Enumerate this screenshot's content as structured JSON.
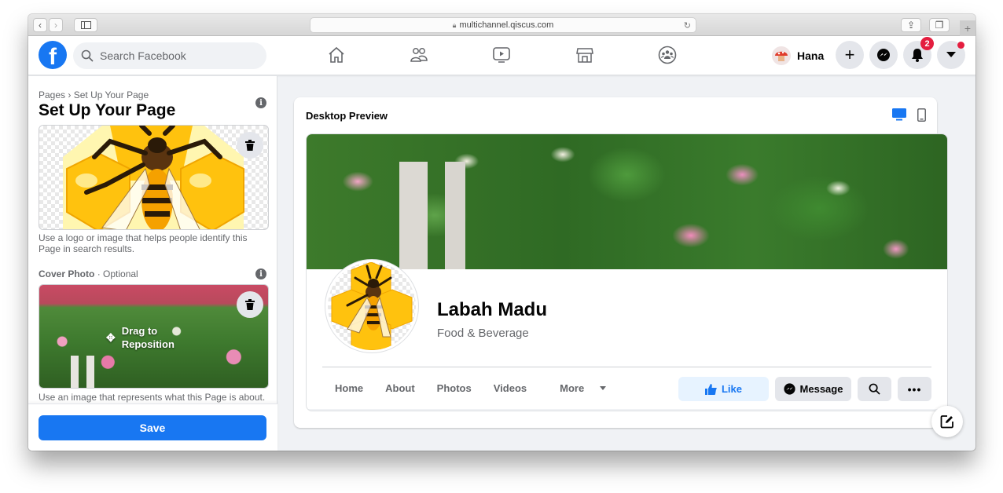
{
  "browser": {
    "url": "multichannel.qiscus.com",
    "back_icon": "chevron-left-icon",
    "forward_icon": "chevron-right-icon"
  },
  "topbar": {
    "search_placeholder": "Search Facebook",
    "nav": [
      "home-icon",
      "friends-icon",
      "watch-icon",
      "marketplace-icon",
      "groups-icon"
    ],
    "profile_name": "Hana",
    "notification_count": "2",
    "brand_color": "#1877f2"
  },
  "sidebar": {
    "breadcrumb_root": "Pages",
    "breadcrumb_sep": "›",
    "breadcrumb_current": "Set Up Your Page",
    "title": "Set Up Your Page",
    "profile_help": "Use a logo or image that helps people identify this Page in search results.",
    "cover_label": "Cover Photo",
    "cover_optional": "· Optional",
    "drag_text_1": "Drag to",
    "drag_text_2": "Reposition",
    "cover_help": "Use an image that represents what this Page is about.",
    "save_label": "Save"
  },
  "preview": {
    "title": "Desktop Preview",
    "page_name": "Labah Madu",
    "category": "Food & Beverage",
    "tabs": [
      "Home",
      "About",
      "Photos",
      "Videos",
      "More"
    ],
    "like_label": "Like",
    "message_label": "Message"
  }
}
